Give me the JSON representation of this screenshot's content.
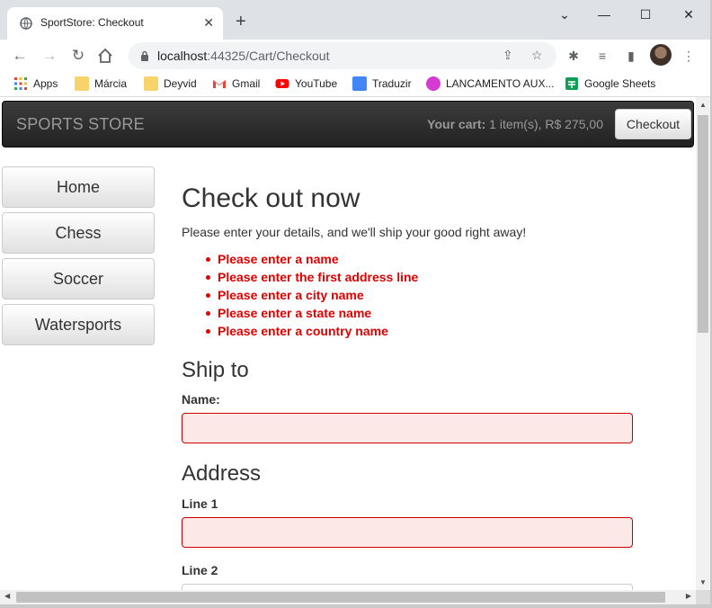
{
  "browser": {
    "tab_title": "SportStore: Checkout",
    "new_tab_label": "+",
    "url_host": "localhost",
    "url_path": ":44325/Cart/Checkout",
    "bookmarks": [
      {
        "label": "Apps",
        "icon": "apps-grid-icon"
      },
      {
        "label": "Márcia",
        "icon": "folder-icon"
      },
      {
        "label": "Deyvid",
        "icon": "folder-icon"
      },
      {
        "label": "Gmail",
        "icon": "gmail-icon"
      },
      {
        "label": "YouTube",
        "icon": "youtube-icon"
      },
      {
        "label": "Traduzir",
        "icon": "translate-icon"
      },
      {
        "label": "LANCAMENTO AUX...",
        "icon": "app-icon"
      },
      {
        "label": "Google Sheets",
        "icon": "sheets-icon"
      }
    ]
  },
  "store": {
    "brand": "SPORTS STORE",
    "cart_label": "Your cart:",
    "cart_summary": "1 item(s), R$ 275,00",
    "checkout_button": "Checkout",
    "categories": [
      "Home",
      "Chess",
      "Soccer",
      "Watersports"
    ]
  },
  "checkout": {
    "title": "Check out now",
    "intro": "Please enter your details, and we'll ship your good right away!",
    "errors": [
      "Please enter a name",
      "Please enter the first address line",
      "Please enter a city name",
      "Please enter a state name",
      "Please enter a country name"
    ],
    "ship_to_heading": "Ship to",
    "name_label": "Name:",
    "address_heading": "Address",
    "line1_label": "Line 1",
    "line2_label": "Line 2"
  },
  "colors": {
    "error_text": "#e00000",
    "invalid_field_bg": "#fde8e8",
    "invalid_field_border": "#cc0000",
    "navbar_bg": "#222222"
  }
}
